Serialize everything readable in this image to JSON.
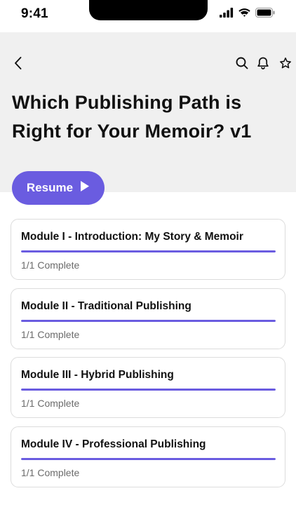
{
  "status_bar": {
    "time": "9:41"
  },
  "header": {
    "title": "Which Publishing Path is Right for Your Memoir? v1",
    "icons": [
      "back-chevron-icon",
      "search-icon",
      "bell-icon",
      "star-icon"
    ]
  },
  "resume": {
    "label": "Resume",
    "icon": "play-icon"
  },
  "colors": {
    "accent": "#6a5ce0",
    "header_bg": "#f0f0f0",
    "card_border": "#dcdcdc",
    "muted_text": "#6b6b6b"
  },
  "modules": [
    {
      "title": "Module I - Introduction: My Story & Memoir",
      "status": "1/1 Complete",
      "progress": 1.0
    },
    {
      "title": "Module II - Traditional Publishing",
      "status": "1/1 Complete",
      "progress": 1.0
    },
    {
      "title": "Module III - Hybrid Publishing",
      "status": "1/1 Complete",
      "progress": 1.0
    },
    {
      "title": "Module IV - Professional Publishing",
      "status": "1/1 Complete",
      "progress": 1.0
    }
  ]
}
